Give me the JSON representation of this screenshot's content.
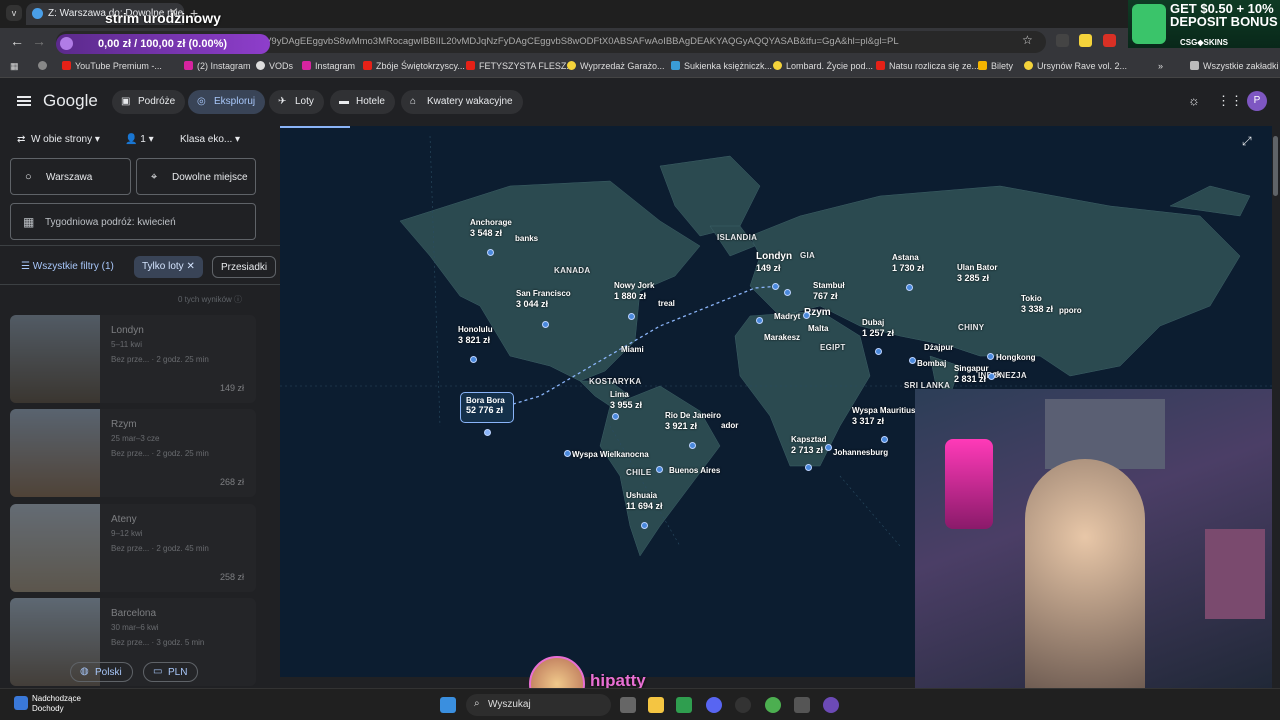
{
  "browser": {
    "tab_title": "Z: Warszawa do: Dowolne miej",
    "url": "?tfs=CBwQAxocagwIAhIIL20vMDgxbV9yDAgEEggvbS8wMmo3MRocagwIBBIIL20vMDJqNzFyDAgCEggvbS8wODFtX0ABSAFwAoIBBAgDEAKYAQGyAQQYASAB&tfu=GgA&hl=pl&gl=PL"
  },
  "bookmarks": [
    "YouTube Premium -...",
    "(2) Instagram",
    "VODs",
    "Instagram",
    "Zbójе Świętokrzyscy...",
    "FETYSZYSTA FLESZ...",
    "Wyprzedaż Garażo...",
    "Sukienka księżniczk...",
    "Lombard. Życie pod...",
    "Natsu rozlicza się ze...",
    "Bilety",
    "Ursynów Rave vol. 2...",
    "Wszystkie zakładki"
  ],
  "overlay": {
    "stream_title": "strim urodzinowy",
    "price_bar": "0,00 zł / 100,00 zł (0.00%)",
    "promo_line1": "GET $0.50 + 10%",
    "promo_line2": "DEPOSIT BONUS",
    "promo_brand": "CSG◆SKINS",
    "chat_user": "hipatty"
  },
  "header": {
    "logo": "Google",
    "chips": [
      "Podróże",
      "Eksploruj",
      "Loty",
      "Hotele",
      "Kwatery wakacyjne"
    ],
    "avatar": "P"
  },
  "sidebar": {
    "trip_type": "W obie strony",
    "passengers": "1",
    "cabin": "Klasa eko...",
    "origin": "Warszawa",
    "destination": "Dowolne miejsce",
    "dates": "Tygodniowa podróż: kwiecień",
    "filters": {
      "all": "Wszystkie filtry (1)",
      "active": "Tylko loty",
      "stops": "Przesiadki"
    },
    "hidden_results": "0 tych wyników",
    "cards": [
      {
        "name": "Londyn",
        "dates": "5–11 kwi",
        "stops": "Bez prze...  ·  2 godz. 25 min",
        "price": "149 zł"
      },
      {
        "name": "Rzym",
        "dates": "25 mar–3 cze",
        "stops": "Bez prze...  ·  2 godz. 25 min",
        "price": "268 zł"
      },
      {
        "name": "Ateny",
        "dates": "9–12 kwi",
        "stops": "Bez prze...  ·  2 godz. 45 min",
        "price": "258 zł"
      },
      {
        "name": "Barcelona",
        "dates": "30 mar–6 kwi",
        "stops": "Bez prze...  ·  3 godz. 5 min",
        "price": ""
      }
    ],
    "footer": {
      "language": "Polski",
      "currency": "PLN"
    }
  },
  "map": {
    "destinations": [
      {
        "city": "Anchorage",
        "price": "3 548 zł"
      },
      {
        "city": "San Francisco",
        "price": "3 044 zł"
      },
      {
        "city": "Nowy Jork",
        "price": "1 880 zł"
      },
      {
        "city": "Honolulu",
        "price": "3 821 zł"
      },
      {
        "city": "Lima",
        "price": "3 955 zł"
      },
      {
        "city": "Rio De Janeiro",
        "price": "3 921 zł"
      },
      {
        "city": "Ushuaia",
        "price": "11 694 zł"
      },
      {
        "city": "Londyn",
        "price": "149 zł"
      },
      {
        "city": "Stambuł",
        "price": "767 zł"
      },
      {
        "city": "Astana",
        "price": "1 730 zł"
      },
      {
        "city": "Ulan Bator",
        "price": "3 285 zł"
      },
      {
        "city": "Tokio",
        "price": "3 338 zł"
      },
      {
        "city": "Dubaj",
        "price": "1 257 zł"
      },
      {
        "city": "Singapur",
        "price": "2 831 zł"
      },
      {
        "city": "Wyspa Mauritius",
        "price": "3 317 zł"
      },
      {
        "city": "Kapsztad",
        "price": "2 713 zł"
      }
    ],
    "bora": {
      "city": "Bora Bora",
      "price": "52 776 zł"
    },
    "countries": [
      "KANADA",
      "ISLANDIA",
      "KOSTARYKA",
      "CHILE",
      "EGIPT",
      "CHINY",
      "SRI LANKA",
      "GIA",
      "INDONEZJA"
    ],
    "cities": [
      "Miami",
      "Wyspa Wielkanocna",
      "Buenos Aires",
      "Rzym",
      "Madryt",
      "Marakesz",
      "Malta",
      "Dżajpur",
      "Bombaj",
      "Hongkong",
      "Johannesburg",
      "banks",
      "treal",
      "ador",
      "pporo",
      "ok"
    ]
  },
  "taskbar": {
    "weather_title": "Nadchodzące",
    "weather_sub": "Dochody",
    "search": "Wyszukaj"
  }
}
